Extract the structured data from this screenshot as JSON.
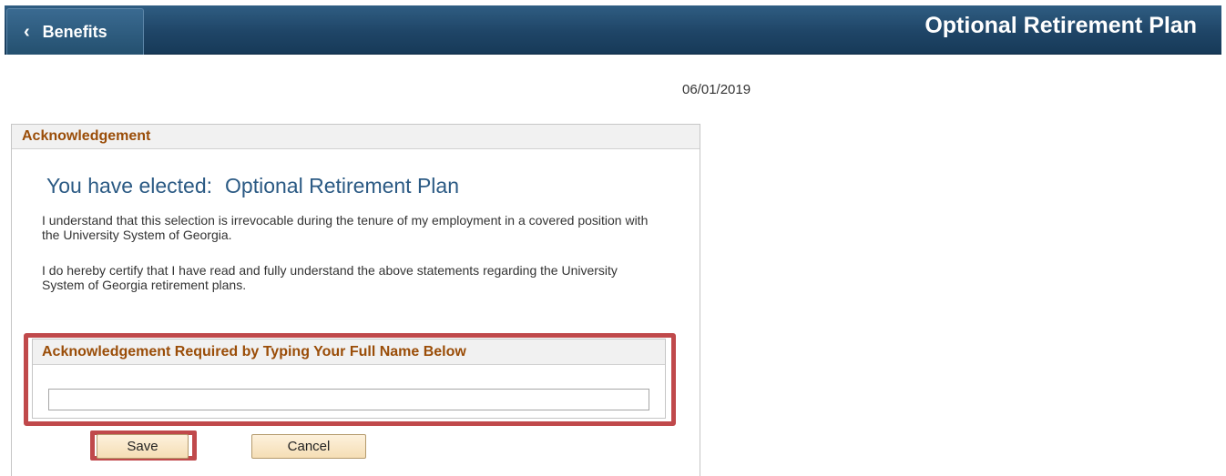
{
  "header": {
    "back_label": "Benefits",
    "title": "Optional Retirement Plan"
  },
  "date": "06/01/2019",
  "panel": {
    "title": "Acknowledgement",
    "elected_prefix": "You have elected:",
    "elected_plan": "Optional Retirement Plan",
    "paragraph1": "I understand that this selection is irrevocable during the tenure of my employment in a covered position with the University System of Georgia.",
    "paragraph2": "I do hereby certify that I have read and fully understand the above statements regarding the University System of Georgia retirement plans."
  },
  "acknowledgement": {
    "title": "Acknowledgement Required by Typing Your Full Name Below",
    "name_value": ""
  },
  "buttons": {
    "save": "Save",
    "cancel": "Cancel"
  },
  "colors": {
    "header_bg": "#1f4567",
    "section_title": "#9a4d08",
    "elected_text": "#2b5a84",
    "highlight": "#c0494b",
    "button_bg": "#f5deb5"
  },
  "icons": {
    "back": "chevron-left-icon"
  }
}
